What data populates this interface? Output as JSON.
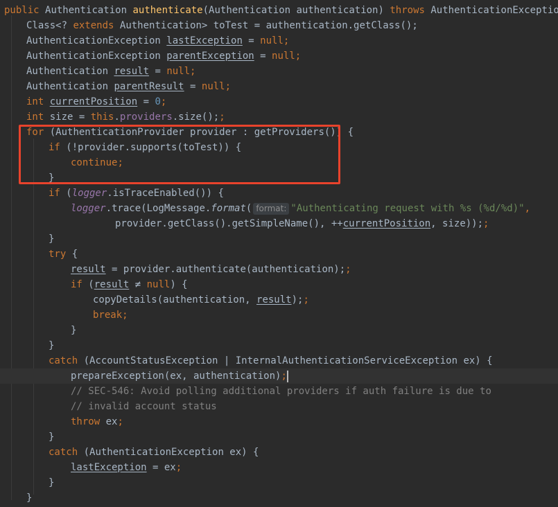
{
  "method_signature": {
    "kw_public": "public",
    "return_type": "Authentication",
    "method_name": "authenticate",
    "params": "(Authentication authentication)",
    "kw_throws": "throws",
    "exception": "AuthenticationException {"
  },
  "lines": {
    "l1_a": "Class<?",
    "l1_kw": "extends",
    "l1_b": " Authentication> toTest = authentication.getClass();",
    "l2_a": "AuthenticationException ",
    "l2_var": "lastException",
    "l2_b": " = ",
    "l2_null": "null",
    "l3_a": "AuthenticationException ",
    "l3_var": "parentException",
    "l3_b": " = ",
    "l3_null": "null",
    "l4_a": "Authentication ",
    "l4_var": "result",
    "l4_b": " = ",
    "l4_null": "null",
    "l5_a": "Authentication ",
    "l5_var": "parentResult",
    "l5_b": " = ",
    "l5_null": "null",
    "l6_kw": "int",
    "l6_var": "currentPosition",
    "l6_b": " = ",
    "l6_num": "0",
    "l7_kw": "int",
    "l7_a": " size = ",
    "l7_this": "this",
    "l7_dot": ".",
    "l7_field": "providers",
    "l7_b": ".size();",
    "l8_kw": "for",
    "l8_a": " (AuthenticationProvider provider : getProviders()) {",
    "l9_kw": "if",
    "l9_a": " (!provider.supports(toTest)) {",
    "l10_kw": "continue",
    "l11": "}",
    "l12_kw": "if",
    "l12_a": " (",
    "l12_field": "logger",
    "l12_b": ".isTraceEnabled()) {",
    "l13_field": "logger",
    "l13_a": ".trace(LogMessage.",
    "l13_fn": "format",
    "l13_b": "(",
    "l13_hint": "format:",
    "l13_str": "\"Authenticating request with %s (%d/%d)\"",
    "l13_c": ",",
    "l14_a": "provider.getClass().getSimpleName(), ++",
    "l14_var": "currentPosition",
    "l14_b": ", size));",
    "l15": "}",
    "l16_kw": "try",
    "l16_a": " {",
    "l17_var": "result",
    "l17_a": " = provider.authenticate(authentication);",
    "l18_kw": "if",
    "l18_a": " (",
    "l18_var": "result",
    "l18_b": " ≠ ",
    "l18_null": "null",
    "l18_c": ") {",
    "l19_a": "copyDetails(authentication, ",
    "l19_var": "result",
    "l19_b": ");",
    "l20_kw": "break",
    "l21": "}",
    "l22": "}",
    "l23_kw": "catch",
    "l23_a": " (AccountStatusException | InternalAuthenticationServiceException ex) {",
    "l24_a": "prepareException(ex, authentication)",
    "l24_semi": ";",
    "l25": "// SEC-546: Avoid polling additional providers if auth failure is due to",
    "l26": "// invalid account status",
    "l27_kw": "throw",
    "l27_a": " ex",
    "l28": "}",
    "l29_kw": "catch",
    "l29_a": " (AuthenticationException ex) {",
    "l30_var": "lastException",
    "l30_a": " = ex",
    "l31": "}",
    "l32": "}"
  },
  "colors": {
    "background": "#2b2b2b",
    "keyword": "#cc7832",
    "method": "#ffc66d",
    "field": "#9876aa",
    "string": "#6a8759",
    "comment": "#808080",
    "number": "#6897bb",
    "highlight_box": "#e8432c"
  }
}
